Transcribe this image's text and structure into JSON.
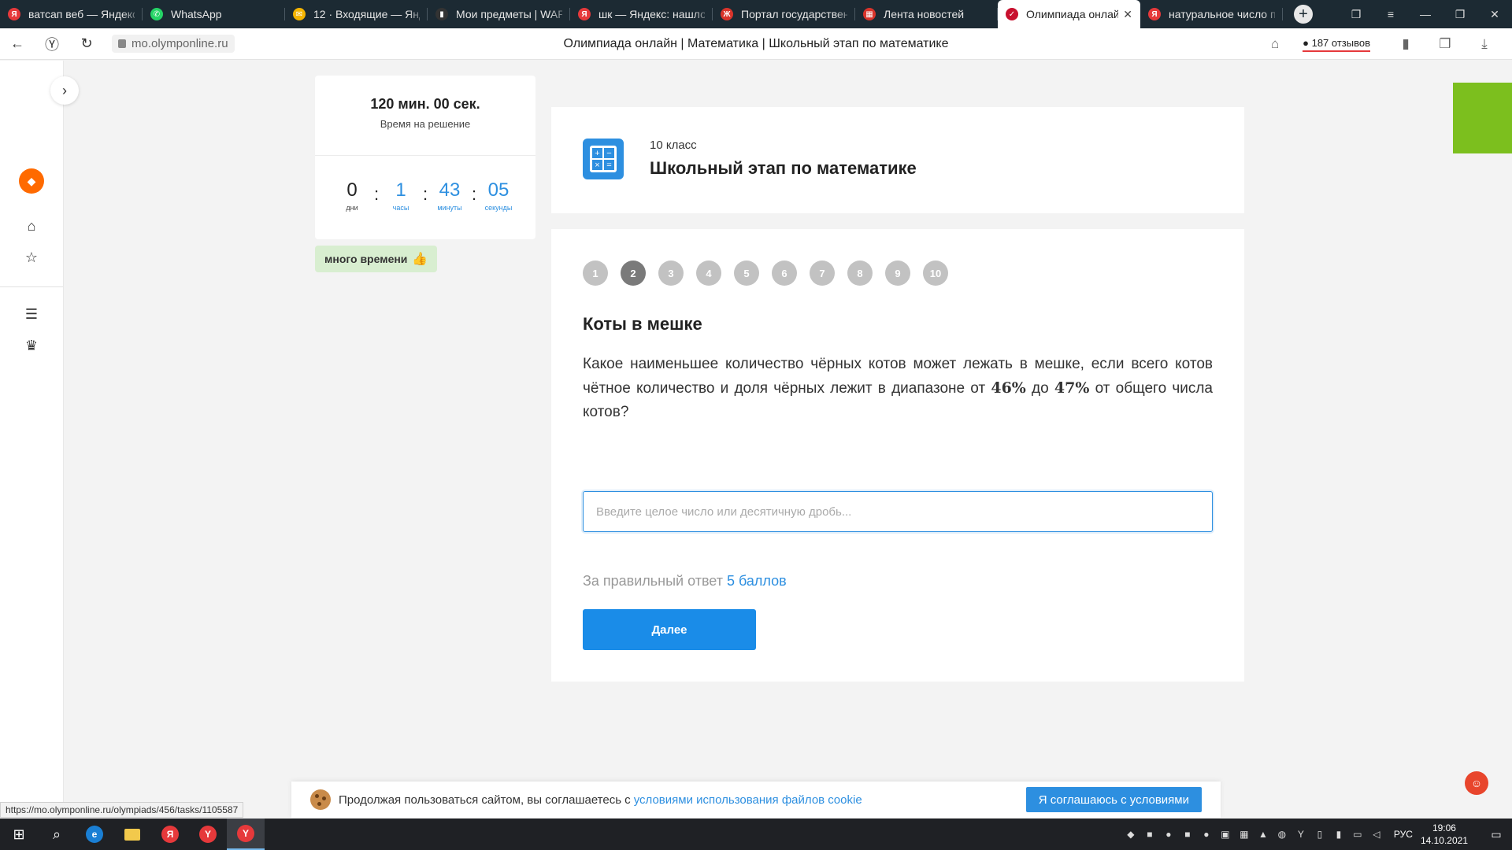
{
  "browser": {
    "tabs": [
      {
        "title": "ватсап веб — Яндекс",
        "favicon_color": "#e6393b",
        "favicon_glyph": "Я"
      },
      {
        "title": "WhatsApp",
        "favicon_color": "#25d366",
        "favicon_glyph": "✆"
      },
      {
        "title": "12 · Входящие — Янде",
        "favicon_color": "#f5b400",
        "favicon_glyph": "✉"
      },
      {
        "title": "Мои предметы | WAR",
        "favicon_color": "#333333",
        "favicon_glyph": "▮"
      },
      {
        "title": "шк — Яндекс: нашлос",
        "favicon_color": "#e6393b",
        "favicon_glyph": "Я"
      },
      {
        "title": "Портал государствен",
        "favicon_color": "#d9342b",
        "favicon_glyph": "Ж"
      },
      {
        "title": "Лента новостей",
        "favicon_color": "#d9342b",
        "favicon_glyph": "▦"
      },
      {
        "title": "Олимпиада онлайн",
        "favicon_color": "#c8102e",
        "favicon_glyph": "✓",
        "active": true
      },
      {
        "title": "натуральное число п",
        "favicon_color": "#e6393b",
        "favicon_glyph": "Я"
      }
    ],
    "url": "mo.olymponline.ru",
    "page_title": "Олимпиада онлайн | Математика | Школьный этап по математике",
    "reviews": "187 отзывов",
    "status_url": "https://mo.olymponline.ru/olympiads/456/tasks/1105587"
  },
  "timer": {
    "total": "120 мин. 00 сек.",
    "caption": "Время на решение",
    "days": {
      "value": "0",
      "label": "дни"
    },
    "hours": {
      "value": "1",
      "label": "часы"
    },
    "minutes": {
      "value": "43",
      "label": "минуты"
    },
    "seconds": {
      "value": "05",
      "label": "секунды"
    },
    "badge": "много времени"
  },
  "olympiad": {
    "grade": "10 класс",
    "title": "Школьный этап по математике"
  },
  "task": {
    "numbers": [
      "1",
      "2",
      "3",
      "4",
      "5",
      "6",
      "7",
      "8",
      "9",
      "10"
    ],
    "active_index": 1,
    "title": "Коты в мешке",
    "text_part1": "Какое наименьшее количество чёрных котов может лежать в мешке, если всего котов чётное количество и доля чёрных лежит в диапазоне от ",
    "value_low": "46%",
    "text_part2": " до ",
    "value_high": "47%",
    "text_part3": " от общего числа котов?",
    "answer_placeholder": "Введите целое число или десятичную дробь...",
    "answer_value": "",
    "points_prefix": "За правильный ответ",
    "points_value": "5 баллов",
    "next_label": "Далее"
  },
  "cookie": {
    "text": "Продолжая пользоваться сайтом, вы соглашаетесь с",
    "link": "условиями использования файлов cookie",
    "accept": "Я соглашаюсь с условиями"
  },
  "taskbar": {
    "lang": "РУС",
    "time": "19:06",
    "date": "14.10.2021"
  },
  "colors": {
    "accent": "#2d8fe0",
    "badge_bg": "#d8eed0",
    "logo": "#ff6a00"
  }
}
